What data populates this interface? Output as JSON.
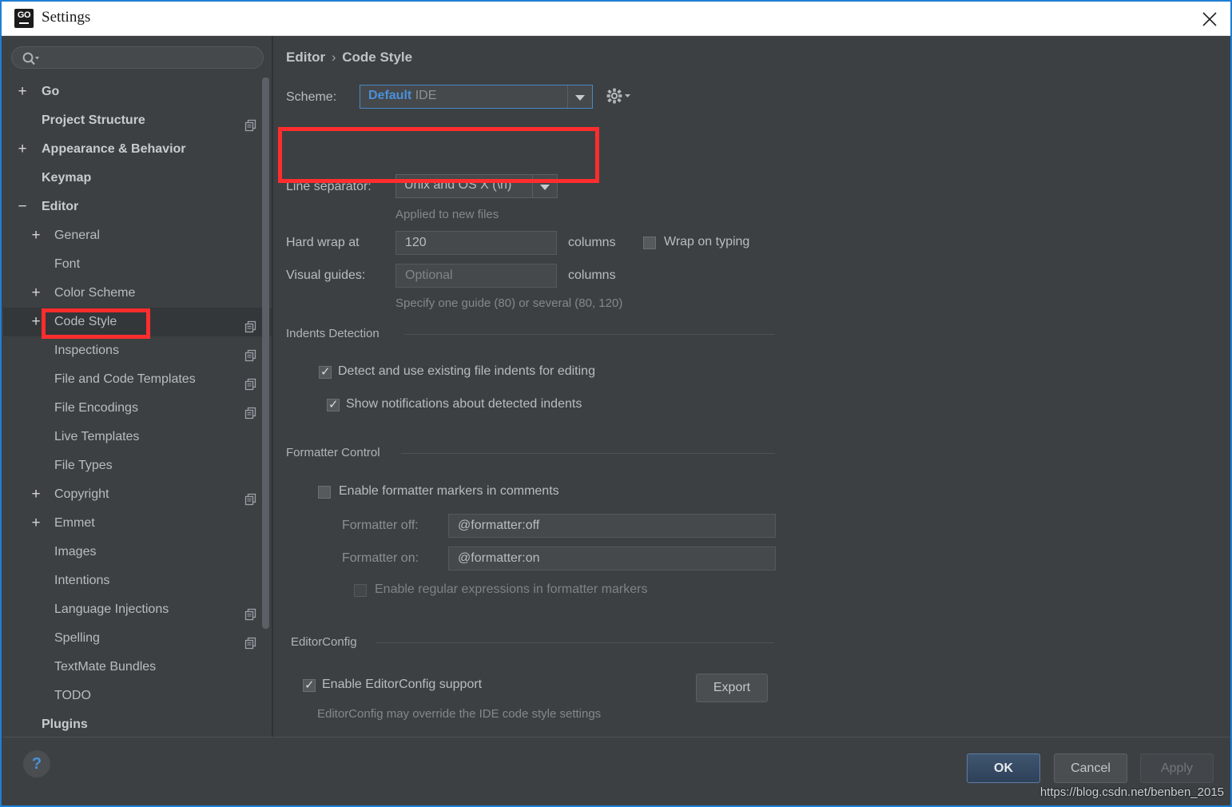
{
  "window": {
    "title": "Settings",
    "app_icon": "go-logo-icon",
    "close_label": "×"
  },
  "sidebar": {
    "search": {
      "placeholder": "",
      "value": "",
      "icon": "search-icon"
    },
    "items": [
      {
        "label": "Go",
        "level": 0,
        "toggle": "+",
        "badge": false
      },
      {
        "label": "Project Structure",
        "level": 0,
        "toggle": "",
        "badge": true
      },
      {
        "label": "Appearance & Behavior",
        "level": 0,
        "toggle": "+",
        "badge": false
      },
      {
        "label": "Keymap",
        "level": 0,
        "toggle": "",
        "badge": false
      },
      {
        "label": "Editor",
        "level": 0,
        "toggle": "−",
        "badge": false
      },
      {
        "label": "General",
        "level": 1,
        "toggle": "+",
        "badge": false
      },
      {
        "label": "Font",
        "level": 1,
        "toggle": "",
        "badge": false
      },
      {
        "label": "Color Scheme",
        "level": 1,
        "toggle": "+",
        "badge": false
      },
      {
        "label": "Code Style",
        "level": 1,
        "toggle": "+",
        "badge": true,
        "selected": true
      },
      {
        "label": "Inspections",
        "level": 1,
        "toggle": "",
        "badge": true
      },
      {
        "label": "File and Code Templates",
        "level": 1,
        "toggle": "",
        "badge": true
      },
      {
        "label": "File Encodings",
        "level": 1,
        "toggle": "",
        "badge": true
      },
      {
        "label": "Live Templates",
        "level": 1,
        "toggle": "",
        "badge": false
      },
      {
        "label": "File Types",
        "level": 1,
        "toggle": "",
        "badge": false
      },
      {
        "label": "Copyright",
        "level": 1,
        "toggle": "+",
        "badge": true
      },
      {
        "label": "Emmet",
        "level": 1,
        "toggle": "+",
        "badge": false
      },
      {
        "label": "Images",
        "level": 1,
        "toggle": "",
        "badge": false
      },
      {
        "label": "Intentions",
        "level": 1,
        "toggle": "",
        "badge": false
      },
      {
        "label": "Language Injections",
        "level": 1,
        "toggle": "",
        "badge": true
      },
      {
        "label": "Spelling",
        "level": 1,
        "toggle": "",
        "badge": true
      },
      {
        "label": "TextMate Bundles",
        "level": 1,
        "toggle": "",
        "badge": false
      },
      {
        "label": "TODO",
        "level": 1,
        "toggle": "",
        "badge": false
      },
      {
        "label": "Plugins",
        "level": 0,
        "toggle": "",
        "badge": false
      }
    ]
  },
  "main": {
    "breadcrumb": {
      "parent": "Editor",
      "separator": "›",
      "current": "Code Style"
    },
    "scheme": {
      "label": "Scheme:",
      "value_name": "Default",
      "value_scope": "IDE",
      "gear_icon": "gear-icon"
    },
    "line_separator": {
      "label": "Line separator:",
      "value": "Unix and OS X (\\n)",
      "hint": "Applied to new files"
    },
    "hard_wrap": {
      "label": "Hard wrap at",
      "value": "120",
      "units": "columns"
    },
    "wrap_on_typing": {
      "label": "Wrap on typing",
      "checked": false
    },
    "visual_guides": {
      "label": "Visual guides:",
      "placeholder": "Optional",
      "value": "",
      "units": "columns",
      "hint": "Specify one guide (80) or several (80, 120)"
    },
    "indents_detection": {
      "title": "Indents Detection",
      "options": [
        {
          "label": "Detect and use existing file indents for editing",
          "checked": true
        },
        {
          "label": "Show notifications about detected indents",
          "checked": true
        }
      ]
    },
    "formatter_control": {
      "title": "Formatter Control",
      "enable_markers": {
        "label": "Enable formatter markers in comments",
        "checked": false
      },
      "formatter_off": {
        "label": "Formatter off:",
        "value": "@formatter:off"
      },
      "formatter_on": {
        "label": "Formatter on:",
        "value": "@formatter:on"
      },
      "enable_regex": {
        "label": "Enable regular expressions in formatter markers",
        "checked": false,
        "disabled": true
      }
    },
    "editorconfig": {
      "title": "EditorConfig",
      "enable": {
        "label": "Enable EditorConfig support",
        "checked": true
      },
      "export_label": "Export",
      "hint": "EditorConfig may override the IDE code style settings"
    }
  },
  "footer": {
    "help_label": "?",
    "ok_label": "OK",
    "cancel_label": "Cancel",
    "apply_label": "Apply",
    "watermark": "https://blog.csdn.net/benben_2015"
  },
  "colors": {
    "accent": "#4a90d9",
    "annotation": "#ff2d2d",
    "background": "#3c4043",
    "window_border": "#1f7fd4"
  }
}
